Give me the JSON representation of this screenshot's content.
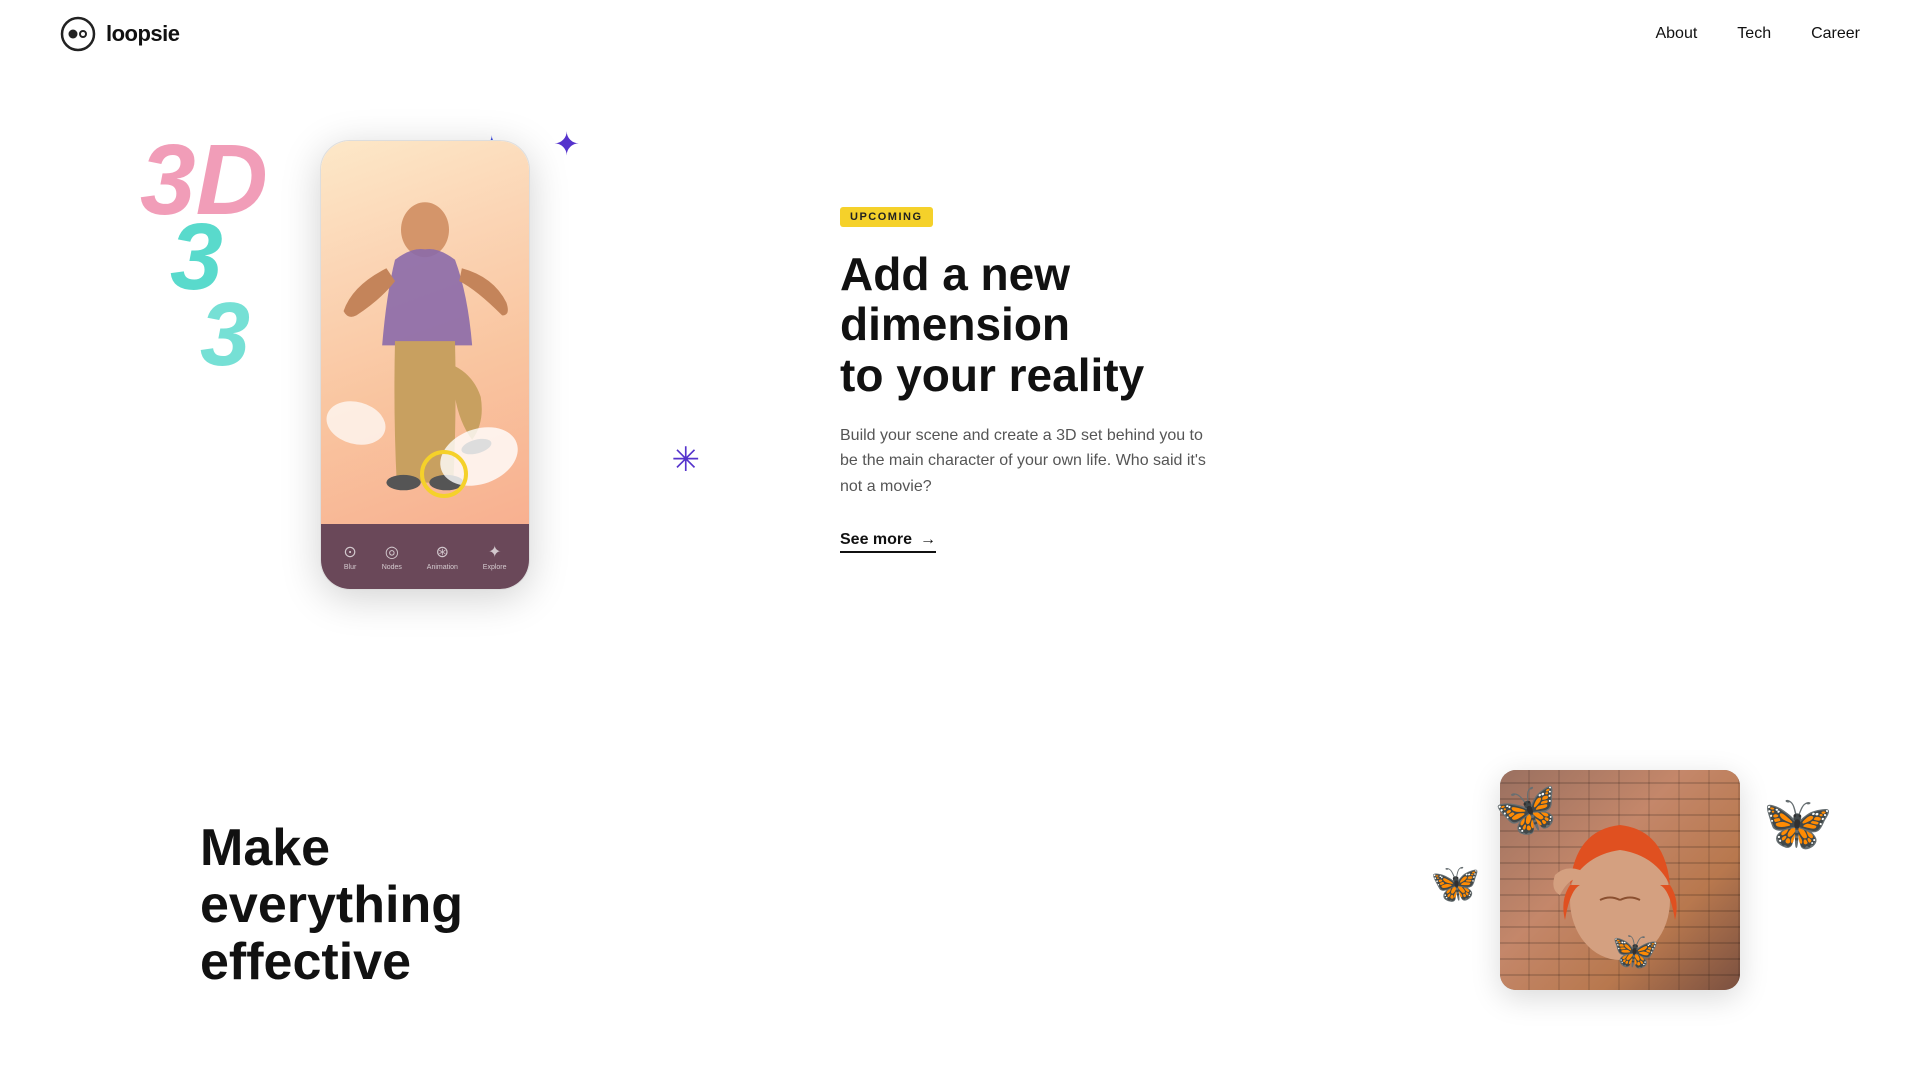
{
  "brand": {
    "name": "loopsie"
  },
  "nav": {
    "links": [
      {
        "id": "about",
        "label": "About"
      },
      {
        "id": "tech",
        "label": "Tech"
      },
      {
        "id": "career",
        "label": "Career"
      }
    ]
  },
  "section_3d": {
    "badge": "UPCOMING",
    "title_line1": "Add a new dimension",
    "title_line2": "to your reality",
    "description": "Build your scene and create a 3D set behind you to be the main character of your own life. Who said it's not a movie?",
    "see_more_label": "See more",
    "deco_numbers": [
      "3D",
      "3",
      "3"
    ]
  },
  "phone_nav": [
    {
      "icon": "⊙",
      "label": "Blur"
    },
    {
      "icon": "◎",
      "label": "Nodes"
    },
    {
      "icon": "⊛",
      "label": "Animation"
    },
    {
      "icon": "✦",
      "label": "Explore"
    }
  ],
  "section_butterflies": {
    "title_line1": "Make everything",
    "title_line2": "effective"
  }
}
